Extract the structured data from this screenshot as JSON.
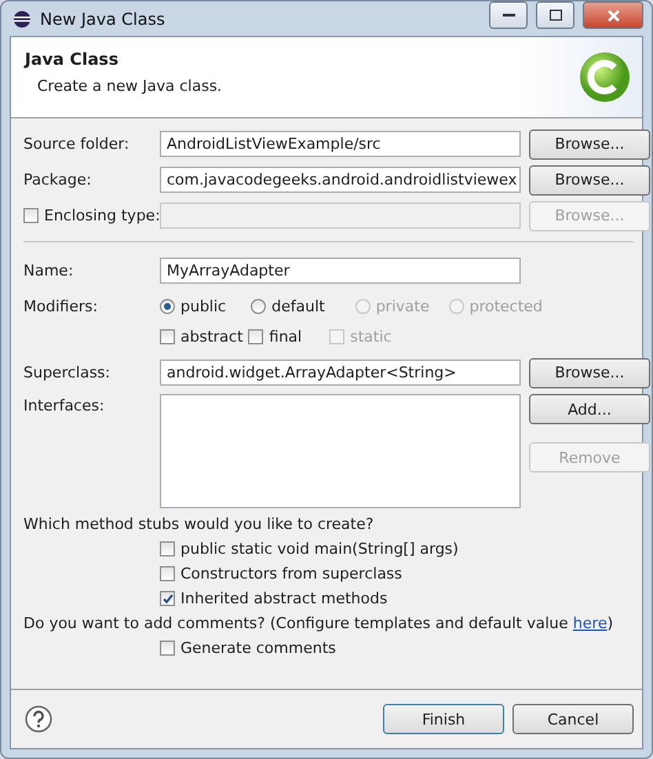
{
  "window": {
    "title": "New Java Class"
  },
  "header": {
    "title": "Java Class",
    "message": "Create a new Java class."
  },
  "location_rows": [
    {
      "kind": "text",
      "label": "Source folder:",
      "value": "AndroidListViewExample/src",
      "disabled": false,
      "button": {
        "label": "Browse...",
        "disabled": false
      }
    },
    {
      "kind": "text",
      "label": "Package:",
      "value": "com.javacodegeeks.android.androidlistviewex",
      "disabled": false,
      "button": {
        "label": "Browse...",
        "disabled": false
      }
    },
    {
      "kind": "check",
      "label": "Enclosing type:",
      "checked": false,
      "disabled": true,
      "button": {
        "label": "Browse...",
        "disabled": true
      }
    }
  ],
  "name": {
    "label": "Name:",
    "value": "MyArrayAdapter"
  },
  "modifiers": {
    "label": "Modifiers:",
    "visibility": [
      {
        "label": "public",
        "selected": true,
        "disabled": false
      },
      {
        "label": "default",
        "selected": false,
        "disabled": false
      },
      {
        "label": "private",
        "selected": false,
        "disabled": true
      },
      {
        "label": "protected",
        "selected": false,
        "disabled": true
      }
    ],
    "flags": [
      {
        "label": "abstract",
        "checked": false,
        "disabled": false
      },
      {
        "label": "final",
        "checked": false,
        "disabled": false
      },
      {
        "label": "static",
        "checked": false,
        "disabled": true
      }
    ]
  },
  "superclass": {
    "label": "Superclass:",
    "value": "android.widget.ArrayAdapter<String>",
    "button": {
      "label": "Browse...",
      "disabled": false
    }
  },
  "interfaces": {
    "label": "Interfaces:",
    "buttons": [
      {
        "label": "Add...",
        "disabled": false
      },
      {
        "label": "Remove",
        "disabled": true
      }
    ]
  },
  "stubs": {
    "question": "Which method stubs would you like to create?",
    "options": [
      {
        "label": "public static void main(String[] args)",
        "checked": false
      },
      {
        "label": "Constructors from superclass",
        "checked": false
      },
      {
        "label": "Inherited abstract methods",
        "checked": true
      }
    ]
  },
  "comments": {
    "prefix": "Do you want to add comments? (Configure templates and default value",
    "link": "here",
    "suffix": ")",
    "options": [
      {
        "label": "Generate comments",
        "checked": false
      }
    ]
  },
  "footer": {
    "buttons": [
      {
        "label": "Finish",
        "default": true
      },
      {
        "label": "Cancel",
        "default": false
      }
    ]
  }
}
